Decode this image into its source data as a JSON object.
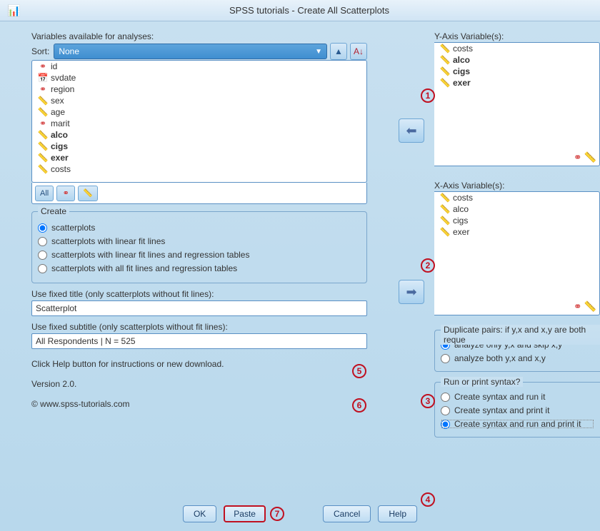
{
  "window": {
    "title": "SPSS tutorials - Create All Scatterplots"
  },
  "left": {
    "vars_label": "Variables available for analyses:",
    "sort_label": "Sort:",
    "sort_value": "None",
    "available": [
      {
        "icon": "nominal",
        "name": "id",
        "bold": false
      },
      {
        "icon": "date",
        "name": "svdate",
        "bold": false
      },
      {
        "icon": "nominal",
        "name": "region",
        "bold": false
      },
      {
        "icon": "scale",
        "name": "sex",
        "bold": false
      },
      {
        "icon": "scale",
        "name": "age",
        "bold": false
      },
      {
        "icon": "nominal",
        "name": "marit",
        "bold": false
      },
      {
        "icon": "scale",
        "name": "alco",
        "bold": true
      },
      {
        "icon": "scale",
        "name": "cigs",
        "bold": true
      },
      {
        "icon": "scale",
        "name": "exer",
        "bold": true
      },
      {
        "icon": "scale",
        "name": "costs",
        "bold": false
      }
    ],
    "filter_all": "All",
    "create_legend": "Create",
    "create_options": [
      "scatterplots",
      "scatterplots with linear fit lines",
      "scatterplots with linear fit lines and regression tables",
      "scatterplots with all fit lines and regression tables"
    ],
    "fixed_title_label": "Use fixed title (only scatterplots without fit lines):",
    "fixed_title_value": "Scatterplot",
    "fixed_sub_label": "Use fixed subtitle (only scatterplots without fit lines):",
    "fixed_sub_value": "All Respondents | N = 525",
    "help_hint": "Click Help button for instructions or new download.",
    "version": "Version 2.0.",
    "copyright": "© www.spss-tutorials.com"
  },
  "right": {
    "y_label": "Y-Axis Variable(s):",
    "x_label": "X-Axis Variable(s):",
    "vars": [
      {
        "icon": "scale",
        "name": "costs"
      },
      {
        "icon": "scale",
        "name": "alco"
      },
      {
        "icon": "scale",
        "name": "cigs"
      },
      {
        "icon": "scale",
        "name": "exer"
      }
    ],
    "dup_legend": "Duplicate pairs: if y,x and x,y are both reque",
    "dup_options": [
      "analyze only y,x and skip x,y",
      "analyze both y,x and x,y"
    ],
    "run_legend": "Run or print syntax?",
    "run_options": [
      "Create syntax and run it",
      "Create syntax and print it",
      "Create syntax and run and print it"
    ]
  },
  "buttons": {
    "ok": "OK",
    "paste": "Paste",
    "cancel": "Cancel",
    "help": "Help"
  }
}
